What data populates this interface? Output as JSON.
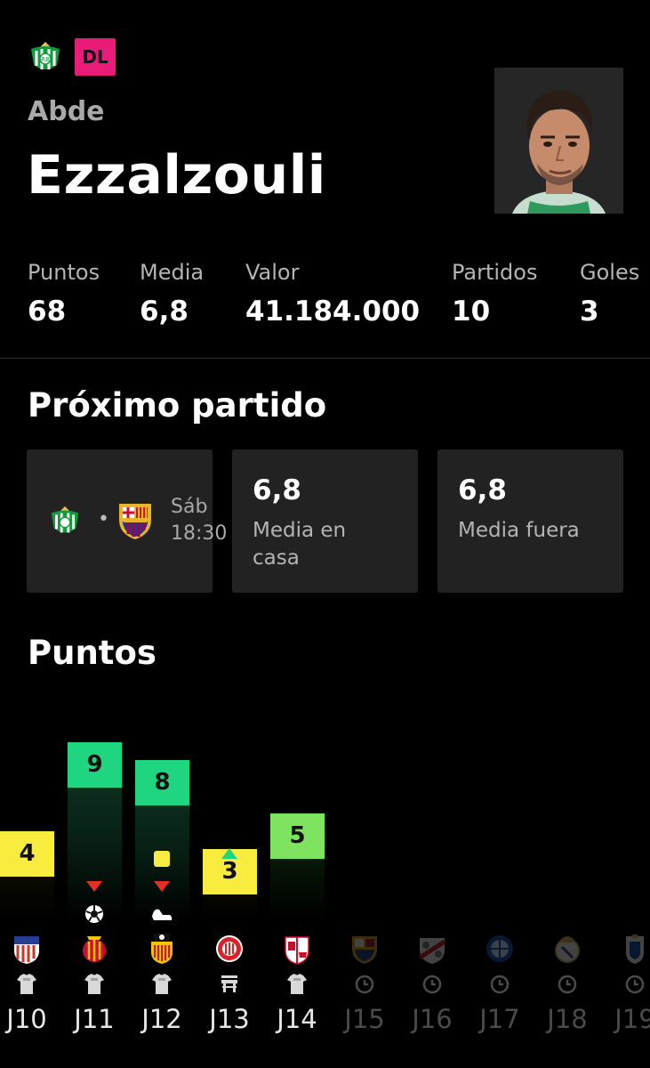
{
  "player": {
    "first_name": "Abde",
    "last_name": "Ezzalzouli",
    "position": "DL",
    "team_crest_icon": "real-betis-crest-icon",
    "position_color": "#ea1c7a"
  },
  "stats": [
    {
      "label": "Puntos",
      "value": "68"
    },
    {
      "label": "Media",
      "value": "6,8"
    },
    {
      "label": "Valor",
      "value": "41.184.000"
    },
    {
      "label": "Partidos",
      "value": "10"
    },
    {
      "label": "Goles",
      "value": "3"
    }
  ],
  "next_match": {
    "title": "Próximo partido",
    "home_crest": "real-betis-crest-icon",
    "away_crest": "fc-barcelona-crest-icon",
    "separator": "•",
    "day": "Sáb",
    "time": "18:30",
    "home_avg": {
      "value": "6,8",
      "label": "Media en casa"
    },
    "away_avg": {
      "value": "6,8",
      "label": "Media fuera"
    }
  },
  "points_section": {
    "title": "Puntos"
  },
  "chart_data": {
    "type": "bar",
    "categories": [
      "J10",
      "J11",
      "J12",
      "J13",
      "J14",
      "J15",
      "J16",
      "J17",
      "J18",
      "J19"
    ],
    "values": [
      4,
      9,
      8,
      3,
      5,
      null,
      null,
      null,
      null,
      null
    ],
    "opponents": [
      "atletico-madrid",
      "mallorca",
      "valencia",
      "girona",
      "sevilla",
      "fc-barcelona",
      "rayo-vallecano",
      "getafe",
      "real-madrid",
      "real-oviedo"
    ],
    "status": [
      "starter",
      "starter",
      "starter",
      "bench",
      "starter",
      "pending",
      "pending",
      "pending",
      "pending",
      "pending"
    ],
    "events": [
      [],
      [
        "substituted-out",
        "goal"
      ],
      [
        "yellow-card",
        "substituted-out",
        "injury"
      ],
      [
        "substituted-in"
      ],
      []
    ],
    "colors": {
      "low": "#f8ec3e",
      "high": "#20d57f",
      "mid": "#7ee35e",
      "card_red": "#e52e24"
    }
  }
}
